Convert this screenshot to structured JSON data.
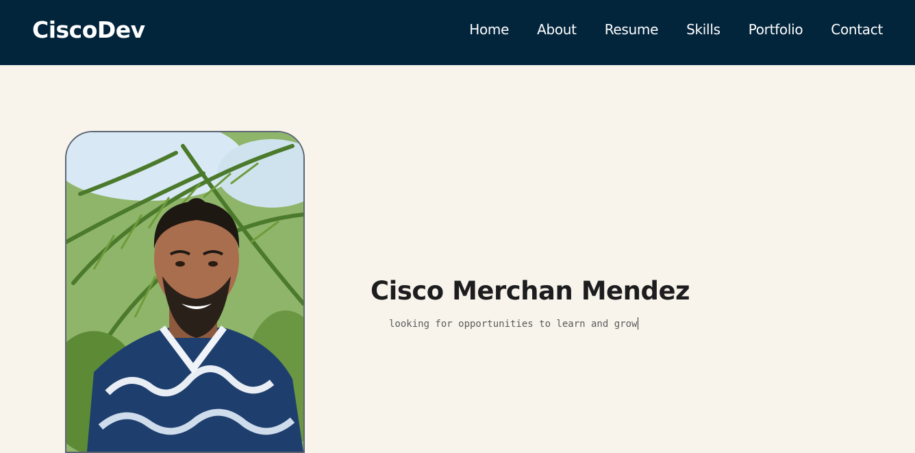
{
  "brand": "CiscoDev",
  "nav": {
    "items": [
      {
        "label": "Home"
      },
      {
        "label": "About"
      },
      {
        "label": "Resume"
      },
      {
        "label": "Skills"
      },
      {
        "label": "Portfolio"
      },
      {
        "label": "Contact"
      }
    ]
  },
  "hero": {
    "name": "Cisco Merchan Mendez",
    "tagline": "looking for opportunities to learn and grow"
  },
  "colors": {
    "navbar": "#03253c",
    "background": "#f8f4eb",
    "heading": "#1d1d1f"
  }
}
